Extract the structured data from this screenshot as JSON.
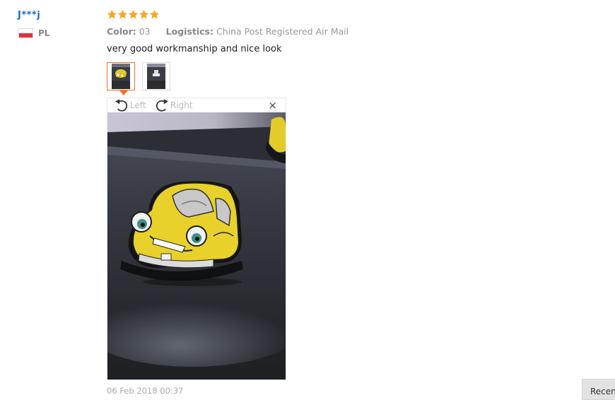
{
  "reviewer": {
    "name": "J***j",
    "country_code": "PL",
    "flag_colors": [
      "#ffffff",
      "#e0323c"
    ]
  },
  "review": {
    "rating": 5,
    "star_color": "#f5a623",
    "color_label": "Color:",
    "color_value": "03",
    "logistics_label": "Logistics:",
    "logistics_value": "China Post Registered Air Mail",
    "text": "very good workmanship and nice look",
    "date": "06 Feb 2018 00:37"
  },
  "thumbnails": [
    {
      "name": "photo-1",
      "selected": true
    },
    {
      "name": "photo-2",
      "selected": false
    }
  ],
  "viewer": {
    "rotate_left_label": "Left",
    "rotate_right_label": "Right",
    "close_label": "×",
    "icons": [
      "rotate-left-icon",
      "rotate-right-icon",
      "close-icon"
    ]
  },
  "footer": {
    "button_label": "Recent"
  },
  "colors": {
    "username": "#1a6bbd",
    "accent_orange": "#f57224"
  }
}
